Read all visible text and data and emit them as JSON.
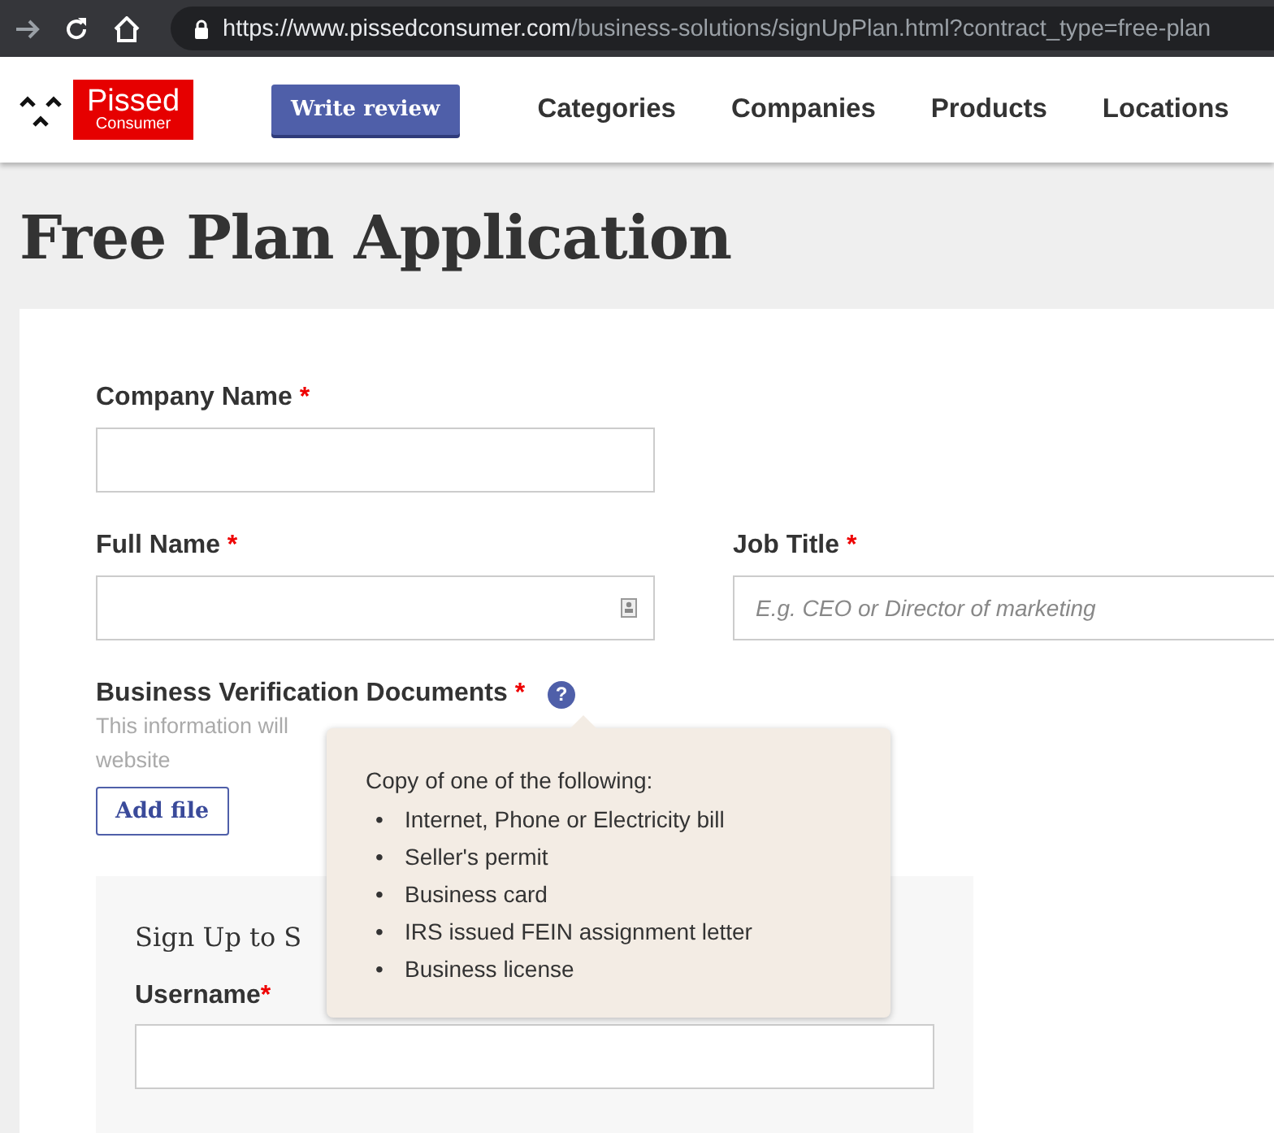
{
  "browser": {
    "url_host": "https://www.pissedconsumer.com",
    "url_path": "/business-solutions/signUpPlan.html?contract_type=free-plan"
  },
  "header": {
    "logo_top": "Pissed",
    "logo_bottom": "Consumer",
    "write_review": "Write review",
    "nav": [
      "Categories",
      "Companies",
      "Products",
      "Locations"
    ]
  },
  "page_title": "Free Plan Application",
  "form": {
    "company_name": {
      "label": "Company Name",
      "required_mark": "*"
    },
    "full_name": {
      "label": "Full Name",
      "required_mark": "*"
    },
    "job_title": {
      "label": "Job Title",
      "required_mark": "*",
      "placeholder": "E.g. CEO or Director of marketing"
    },
    "documents": {
      "label": "Business Verification Documents",
      "required_mark": "*",
      "help": "?",
      "hint": [
        "This information will",
        "website"
      ],
      "add_file": "Add file"
    },
    "signup": {
      "title": "Sign Up to S",
      "username_label": "Username",
      "required_mark": "*"
    }
  },
  "tooltip": {
    "intro": "Copy of one of the following:",
    "bullet": "•",
    "items": [
      "Internet, Phone or Electricity bill",
      "Seller's permit",
      "Business card",
      "IRS issued FEIN assignment letter",
      "Business license"
    ]
  }
}
